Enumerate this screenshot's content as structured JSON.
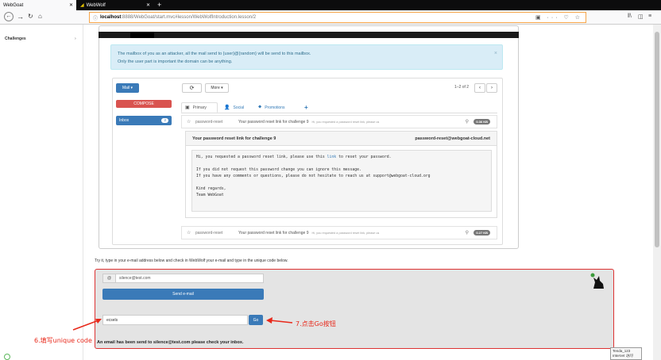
{
  "browser": {
    "tabs": [
      {
        "label": "WebGoat"
      },
      {
        "label": "WebWolf"
      }
    ],
    "url_host": "localhost",
    "url_path": ":8888/WebGoat/start.mvc#lesson/WebWolfIntroduction.lesson/2"
  },
  "sidebar": {
    "items": [
      {
        "label": "Challenges"
      }
    ]
  },
  "alert": {
    "line1": "The mailbox of you as an attacker, all the mail send to {user}@{random} will be send to this mailbox.",
    "line2": "Only the user part is important the domain can be anything."
  },
  "mail": {
    "mail_button": "Mail ▾",
    "compose": "COMPOSE",
    "inbox_label": "Inbox",
    "inbox_count": "2",
    "more_button": "More ▾",
    "pager": "1–2 of 2",
    "tabs": [
      {
        "label": "Primary"
      },
      {
        "label": "Social"
      },
      {
        "label": "Promotions"
      }
    ],
    "rows": [
      {
        "sender": "password-reset",
        "subject": "Your password reset link for challenge 9",
        "snippet": "Hi, you requested a password reset link, please us",
        "size": "0.36 KB"
      },
      {
        "sender": "password-reset",
        "subject": "Your password reset link for challenge 9",
        "snippet": "Hi, you requested a password reset link, please us",
        "size": "0.27 KB"
      }
    ],
    "open_message": {
      "subject": "Your password reset link for challenge 9",
      "from": "password-reset@webgoat-cloud.net",
      "body_line1a": "Hi, you requested a password reset link, please use this ",
      "body_link": "link",
      "body_line1b": " to reset your password.",
      "body_line2": "If you did not request this password change you can ignore this message.",
      "body_line3": "If you have any comments or questions, please do not hesitate to reach us at support@webgoat-cloud.org",
      "body_line4": "Kind regards,",
      "body_line5": "Team WebGoat"
    }
  },
  "tryit": {
    "instruction": "Try it, type in your e-mail address below and check in WebWolf your e-mail and type in the unique code below.",
    "email_addon": "@",
    "email_value": "silence@test.com",
    "send_button": "Send e-mail",
    "code_value": "ecsels",
    "go_button": "Go",
    "result": "An email has been send to silence@test.com please check your inbox."
  },
  "annotations": {
    "fill_code": "6.填写unique code",
    "click_go": "7.点击Go按钮"
  },
  "tray": {
    "line1": "Tenda_123",
    "line2": "Internet 访问"
  },
  "colors": {
    "primary": "#3a7ab8",
    "danger": "#d9534f",
    "annotation": "#e8281a",
    "url_highlight": "#f7a64a"
  }
}
